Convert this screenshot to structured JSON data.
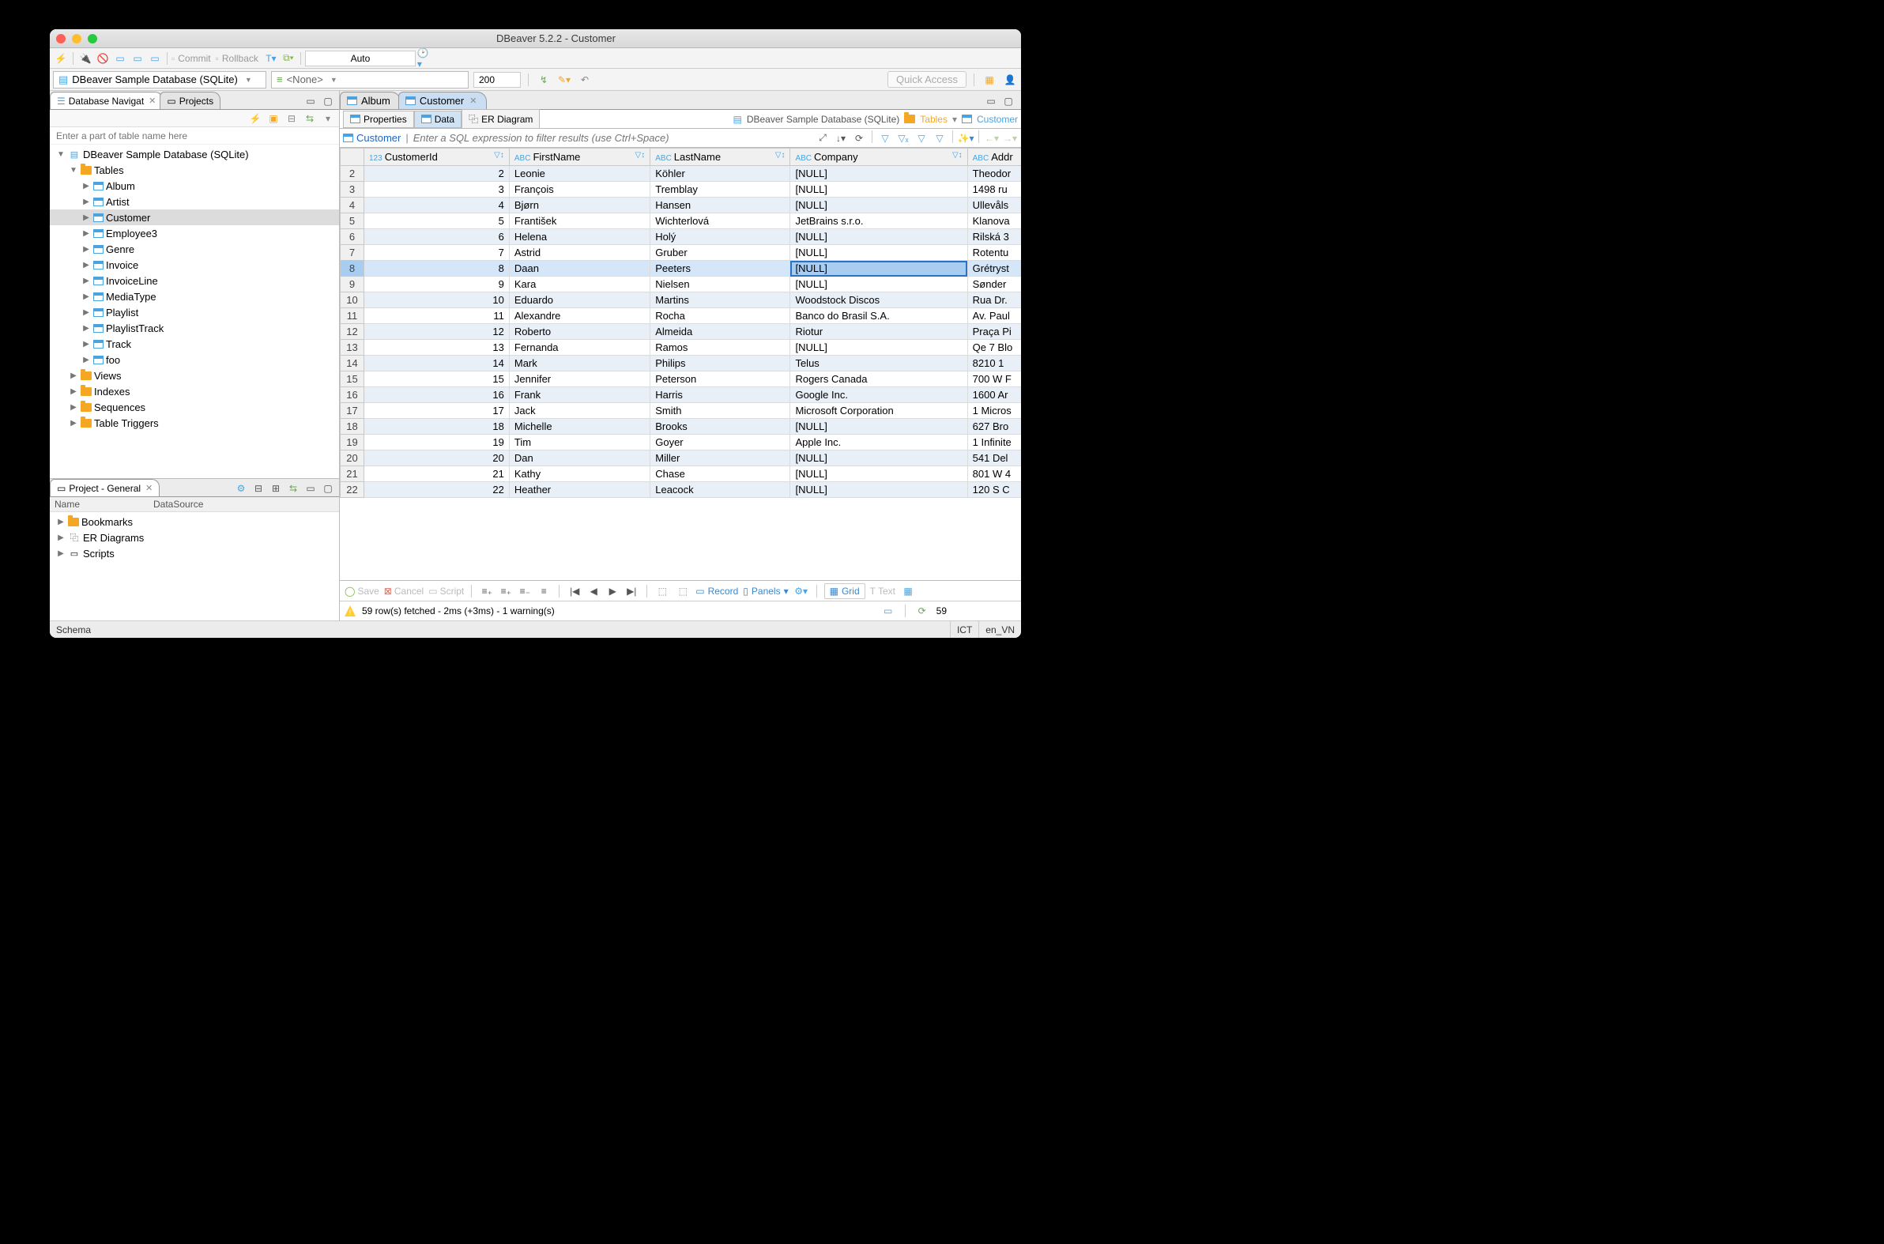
{
  "window": {
    "title": "DBeaver 5.2.2 - Customer"
  },
  "toolbar": {
    "commit": "Commit",
    "rollback": "Rollback",
    "auto": "Auto",
    "qa": "Quick Access"
  },
  "dscombo": {
    "database": "DBeaver Sample Database (SQLite)",
    "schema": "<None>",
    "limit": "200"
  },
  "left_tabs": {
    "nav": "Database Navigat",
    "proj": "Projects"
  },
  "filter_placeholder": "Enter a part of table name here",
  "tree": {
    "root": "DBeaver Sample Database (SQLite)",
    "tables_label": "Tables",
    "tables": [
      "Album",
      "Artist",
      "Customer",
      "Employee3",
      "Genre",
      "Invoice",
      "InvoiceLine",
      "MediaType",
      "Playlist",
      "PlaylistTrack",
      "Track",
      "foo"
    ],
    "selected": "Customer",
    "folders": [
      "Views",
      "Indexes",
      "Sequences",
      "Table Triggers"
    ]
  },
  "project_panel": {
    "title": "Project - General",
    "cols": [
      "Name",
      "DataSource"
    ],
    "items": [
      "Bookmarks",
      "ER Diagrams",
      "Scripts"
    ]
  },
  "editor_tabs": [
    {
      "label": "Album",
      "active": false
    },
    {
      "label": "Customer",
      "active": true
    }
  ],
  "sub_tabs": [
    {
      "label": "Properties",
      "active": false
    },
    {
      "label": "Data",
      "active": true
    },
    {
      "label": "ER Diagram",
      "active": false
    }
  ],
  "breadcrumb": {
    "db": "DBeaver Sample Database (SQLite)",
    "tables": "Tables",
    "table": "Customer"
  },
  "filter_row": {
    "lbl": "Customer",
    "placeholder": "Enter a SQL expression to filter results (use Ctrl+Space)"
  },
  "columns": [
    "CustomerId",
    "FirstName",
    "LastName",
    "Company",
    "Addr"
  ],
  "col_types": [
    "123",
    "ABC",
    "ABC",
    "ABC",
    "ABC"
  ],
  "rows": [
    {
      "n": 2,
      "id": 2,
      "fn": "Leonie",
      "ln": "Köhler",
      "co": "[NULL]",
      "ad": "Theodor"
    },
    {
      "n": 3,
      "id": 3,
      "fn": "François",
      "ln": "Tremblay",
      "co": "[NULL]",
      "ad": "1498 ru"
    },
    {
      "n": 4,
      "id": 4,
      "fn": "Bjørn",
      "ln": "Hansen",
      "co": "[NULL]",
      "ad": "Ullevåls"
    },
    {
      "n": 5,
      "id": 5,
      "fn": "František",
      "ln": "Wichterlová",
      "co": "JetBrains s.r.o.",
      "ad": "Klanova"
    },
    {
      "n": 6,
      "id": 6,
      "fn": "Helena",
      "ln": "Holý",
      "co": "[NULL]",
      "ad": "Rilská 3"
    },
    {
      "n": 7,
      "id": 7,
      "fn": "Astrid",
      "ln": "Gruber",
      "co": "[NULL]",
      "ad": "Rotentu"
    },
    {
      "n": 8,
      "id": 8,
      "fn": "Daan",
      "ln": "Peeters",
      "co": "[NULL]",
      "ad": "Grétryst"
    },
    {
      "n": 9,
      "id": 9,
      "fn": "Kara",
      "ln": "Nielsen",
      "co": "[NULL]",
      "ad": "Sønder"
    },
    {
      "n": 10,
      "id": 10,
      "fn": "Eduardo",
      "ln": "Martins",
      "co": "Woodstock Discos",
      "ad": "Rua Dr."
    },
    {
      "n": 11,
      "id": 11,
      "fn": "Alexandre",
      "ln": "Rocha",
      "co": "Banco do Brasil S.A.",
      "ad": "Av. Paul"
    },
    {
      "n": 12,
      "id": 12,
      "fn": "Roberto",
      "ln": "Almeida",
      "co": "Riotur",
      "ad": "Praça Pi"
    },
    {
      "n": 13,
      "id": 13,
      "fn": "Fernanda",
      "ln": "Ramos",
      "co": "[NULL]",
      "ad": "Qe 7 Blo"
    },
    {
      "n": 14,
      "id": 14,
      "fn": "Mark",
      "ln": "Philips",
      "co": "Telus",
      "ad": "8210 1"
    },
    {
      "n": 15,
      "id": 15,
      "fn": "Jennifer",
      "ln": "Peterson",
      "co": "Rogers Canada",
      "ad": "700 W F"
    },
    {
      "n": 16,
      "id": 16,
      "fn": "Frank",
      "ln": "Harris",
      "co": "Google Inc.",
      "ad": "1600 Ar"
    },
    {
      "n": 17,
      "id": 17,
      "fn": "Jack",
      "ln": "Smith",
      "co": "Microsoft Corporation",
      "ad": "1 Micros"
    },
    {
      "n": 18,
      "id": 18,
      "fn": "Michelle",
      "ln": "Brooks",
      "co": "[NULL]",
      "ad": "627 Bro"
    },
    {
      "n": 19,
      "id": 19,
      "fn": "Tim",
      "ln": "Goyer",
      "co": "Apple Inc.",
      "ad": "1 Infinite"
    },
    {
      "n": 20,
      "id": 20,
      "fn": "Dan",
      "ln": "Miller",
      "co": "[NULL]",
      "ad": "541 Del"
    },
    {
      "n": 21,
      "id": 21,
      "fn": "Kathy",
      "ln": "Chase",
      "co": "[NULL]",
      "ad": "801 W 4"
    },
    {
      "n": 22,
      "id": 22,
      "fn": "Heather",
      "ln": "Leacock",
      "co": "[NULL]",
      "ad": "120 S C"
    }
  ],
  "selected_cell": {
    "row": 8,
    "col": "co"
  },
  "bottom_bar": {
    "save": "Save",
    "cancel": "Cancel",
    "script": "Script",
    "record": "Record",
    "panels": "Panels",
    "grid": "Grid",
    "text": "Text"
  },
  "status_msg": "59 row(s) fetched - 2ms (+3ms) - 1 warning(s)",
  "row_count": "59",
  "footer": {
    "schema": "Schema",
    "tz": "ICT",
    "locale": "en_VN"
  }
}
